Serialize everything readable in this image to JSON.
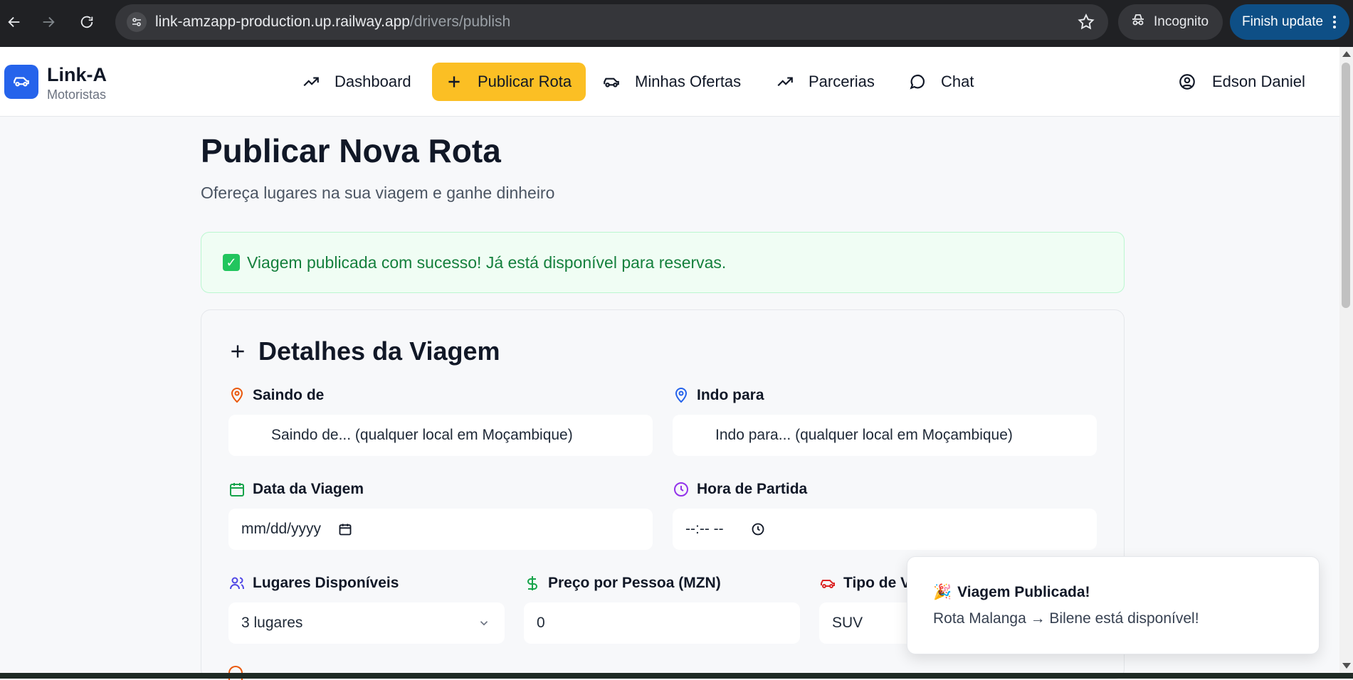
{
  "browser": {
    "url_host": "link-amzapp-production.up.railway.app",
    "url_path": "/drivers/publish",
    "incognito_label": "Incognito",
    "finish_update_label": "Finish update"
  },
  "header": {
    "brand_title": "Link-A",
    "brand_subtitle": "Motoristas",
    "nav": {
      "dashboard": "Dashboard",
      "publicar_rota": "Publicar Rota",
      "minhas_ofertas": "Minhas Ofertas",
      "parcerias": "Parcerias",
      "chat": "Chat"
    },
    "user_name": "Edson Daniel"
  },
  "main": {
    "title": "Publicar Nova Rota",
    "subtitle": "Ofereça lugares na sua viagem e ganhe dinheiro",
    "success_message": "Viagem publicada com sucesso! Já está disponível para reservas.",
    "card": {
      "title": "Detalhes da Viagem",
      "from_label": "Saindo de",
      "from_placeholder": "Saindo de... (qualquer local em Moçambique)",
      "to_label": "Indo para",
      "to_placeholder": "Indo para... (qualquer local em Moçambique)",
      "date_label": "Data da Viagem",
      "date_value": "mm/dd/yyyy",
      "time_label": "Hora de Partida",
      "time_value": "--:-- --",
      "seats_label": "Lugares Disponíveis",
      "seats_value": "3 lugares",
      "price_label": "Preço por Pessoa (MZN)",
      "price_value": "0",
      "vehicle_label": "Tipo de V",
      "vehicle_value": "SUV"
    }
  },
  "toast": {
    "emoji": "🎉",
    "title": "Viagem Publicada!",
    "body": "Rota Malanga → Bilene está disponível!"
  },
  "colors": {
    "accent_yellow": "#fbbf24",
    "brand_blue": "#2563eb",
    "success_green": "#15803d"
  }
}
